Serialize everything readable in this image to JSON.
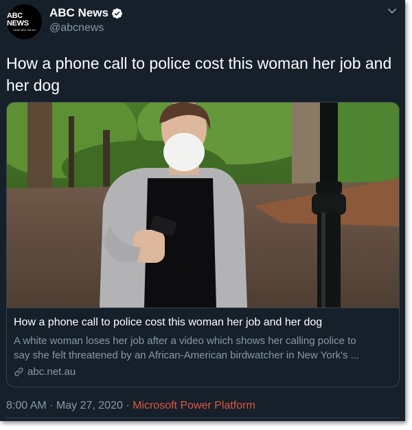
{
  "account": {
    "display_name": "ABC News",
    "handle": "@abcnews",
    "avatar_logo": "ABC NEWS",
    "avatar_url": "news.abc.net.au",
    "verified": true
  },
  "tweet": {
    "text": "How a phone call to police cost this woman her job and her dog",
    "timestamp": "8:00 AM · May 27, 2020",
    "separator": " · ",
    "source": "Microsoft Power Platform"
  },
  "card": {
    "title": "How a phone call to police cost this woman her job and her dog",
    "description_line1": "A white woman loses her job after a video which shows her calling police to",
    "description_line2": "say she felt threatened by an African-American birdwatcher in New York's ...",
    "domain": "abc.net.au"
  },
  "icons": {
    "verified": "verified-badge-icon",
    "caret": "chevron-down-icon",
    "link": "link-icon"
  },
  "colors": {
    "background": "#15202b",
    "text_secondary": "#8899a6",
    "border": "#38444d",
    "source_link": "#e0573f"
  }
}
